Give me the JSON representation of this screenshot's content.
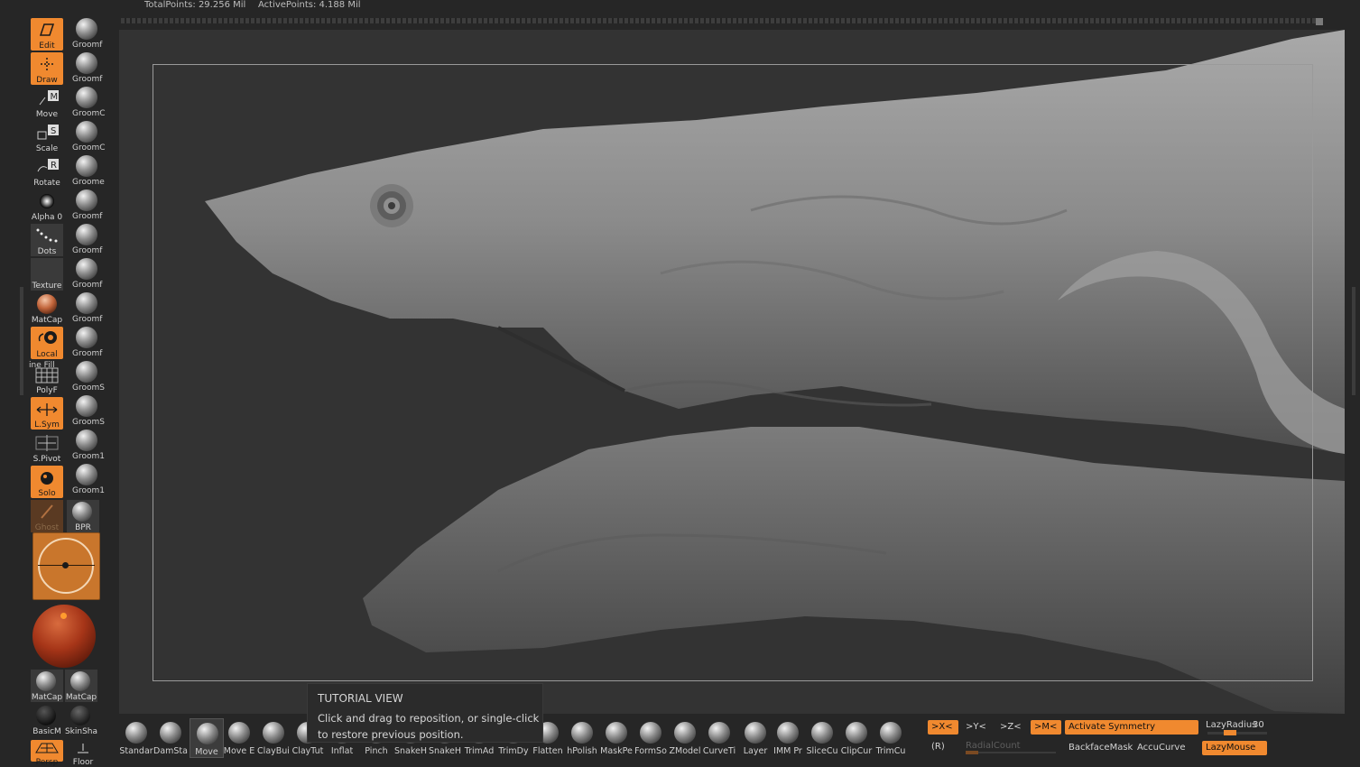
{
  "status": {
    "total_points": "TotalPoints: 29.256 Mil",
    "active_points": "ActivePoints: 4.188 Mil"
  },
  "left_tools": [
    {
      "label": "Edit",
      "state": "on",
      "icon": "edit-icon"
    },
    {
      "label": "Draw",
      "state": "on",
      "icon": "draw-icon"
    },
    {
      "label": "Move",
      "state": "off",
      "icon": "move-icon"
    },
    {
      "label": "Scale",
      "state": "off",
      "icon": "scale-icon"
    },
    {
      "label": "Rotate",
      "state": "off",
      "icon": "rotate-icon"
    },
    {
      "label": "Alpha 0",
      "state": "off",
      "icon": "alpha-icon"
    },
    {
      "label": "Dots",
      "state": "off",
      "icon": "dots-stroke-icon"
    },
    {
      "label": "Texture",
      "state": "off",
      "icon": "texture-icon"
    },
    {
      "label": "MatCap",
      "state": "off",
      "icon": "matcap-icon"
    },
    {
      "label": "Local",
      "state": "on",
      "icon": "local-icon"
    },
    {
      "label": "PolyF",
      "state": "off",
      "icon": "polyframe-icon"
    },
    {
      "label": "L.Sym",
      "state": "on",
      "icon": "lsym-icon"
    },
    {
      "label": "S.Pivot",
      "state": "off",
      "icon": "spivot-icon"
    },
    {
      "label": "Solo",
      "state": "on",
      "icon": "solo-icon"
    },
    {
      "label": "Ghost",
      "state": "dim",
      "icon": "ghost-icon"
    }
  ],
  "line_fill_label": "ine Fill",
  "bpr_label": "BPR",
  "groom_brushes": [
    "Groomf",
    "Groomf",
    "GroomC",
    "GroomC",
    "Groome",
    "Groomf",
    "Groomf",
    "Groomf",
    "Groomf",
    "Groomf",
    "GroomS",
    "GroomS",
    "Groom1",
    "Groom1"
  ],
  "materials": [
    {
      "label": "MatCap"
    },
    {
      "label": "MatCap"
    },
    {
      "label": "BasicM"
    },
    {
      "label": "SkinSha"
    }
  ],
  "bottom_left_labels": [
    "Persp",
    "Floor"
  ],
  "tooltip": {
    "title": "TUTORIAL VIEW",
    "body": "Click and drag to reposition, or single-click to restore previous position."
  },
  "bottom_brushes": [
    "Standar",
    "DamSta",
    "Move",
    "Move E",
    "ClayBui",
    "ClayTut",
    "Inflat",
    "Pinch",
    "SnakeH",
    "SnakeH",
    "TrimAd",
    "TrimDy",
    "Flatten",
    "hPolish",
    "MaskPe",
    "FormSo",
    "ZModel",
    "CurveTi",
    "Layer",
    "IMM Pr",
    "SliceCu",
    "ClipCur",
    "TrimCu"
  ],
  "selected_bottom_brush": "Move",
  "symmetry": {
    "x": ">X<",
    "y": ">Y<",
    "z": ">Z<",
    "m": ">M<",
    "activate": "Activate Symmetry",
    "r": "(R)",
    "radial_count": "RadialCount"
  },
  "lazy": {
    "radius_label": "LazyRadius",
    "radius_value": "30",
    "backface": "BackfaceMask",
    "accucurve": "AccuCurve",
    "lazymouse": "LazyMouse"
  },
  "colors": {
    "accent": "#f0892f",
    "bg": "#262626",
    "canvas": "#333333"
  }
}
